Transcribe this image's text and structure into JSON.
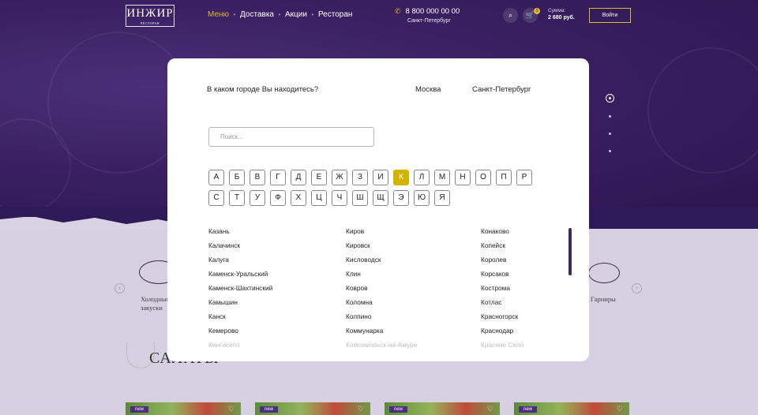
{
  "header": {
    "logo_text": "ИНЖИР",
    "logo_sub": "РЕСТОРАН",
    "nav": [
      "Меню",
      "Доставка",
      "Акции",
      "Ресторан"
    ],
    "phone": "8 800 000 00 00",
    "city": "Санкт-Петербург",
    "sum_label": "Сумма:",
    "sum_value": "2 680 руб.",
    "cart_count": "3",
    "login_label": "Войти"
  },
  "colors": {
    "accent": "#e0b92a",
    "purple": "#3a2062",
    "active_letter": "#d4b200"
  },
  "background": {
    "category_left": "Холодные закуски",
    "category_right": "Гарниры",
    "section_title": "САЛАТЫ",
    "card_badge": "new"
  },
  "modal": {
    "question": "В каком городе Вы находитесь?",
    "quick_cities": [
      "Москва",
      "Санкт-Петербург"
    ],
    "search_placeholder": "Поиск...",
    "letters_row1": [
      "А",
      "Б",
      "В",
      "Г",
      "Д",
      "Е",
      "Ж",
      "З",
      "И",
      "К",
      "Л",
      "М",
      "Н",
      "О",
      "П",
      "Р"
    ],
    "letters_row2": [
      "С",
      "Т",
      "У",
      "Ф",
      "Х",
      "Ц",
      "Ч",
      "Ш",
      "Щ",
      "Э",
      "Ю",
      "Я"
    ],
    "active_letter": "К",
    "columns": [
      [
        "Казань",
        "Калачинск",
        "Калуга",
        "Каменск-Уральский",
        "Каменск-Шахтинский",
        "Камышин",
        "Канск",
        "Кемерово",
        "Кингисепп"
      ],
      [
        "Киров",
        "Кировск",
        "Кисловодск",
        "Клин",
        "Ковров",
        "Коломна",
        "Колпино",
        "Коммунарка",
        "Комсомольск-на-Амуре"
      ],
      [
        "Конаково",
        "Копейск",
        "Королев",
        "Корсаков",
        "Кострома",
        "Котлас",
        "Красногорск",
        "Краснодар",
        "Красное Село"
      ]
    ]
  }
}
